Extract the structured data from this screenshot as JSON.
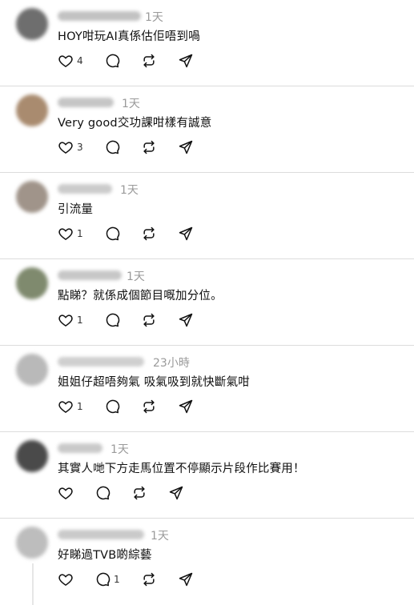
{
  "posts": [
    {
      "time": "1天",
      "text": "HOY咁玩AI真係估佢唔到喎",
      "likes": "4",
      "replies": "",
      "avatar_color": "#6e6e6e",
      "name_color": "#c2c2c2"
    },
    {
      "time": "1天",
      "text": "Very good交功課咁樣有誠意",
      "likes": "3",
      "replies": "",
      "avatar_color": "#a98b6f",
      "name_color": "#c5c5c5"
    },
    {
      "time": "1天",
      "text": "引流量",
      "likes": "1",
      "replies": "",
      "avatar_color": "#a0948a",
      "name_color": "#cbcbcb"
    },
    {
      "time": "1天",
      "text": "點睇？就係成個節目嘅加分位。",
      "likes": "1",
      "replies": "",
      "avatar_color": "#7f8a6e",
      "name_color": "#c7c7c7"
    },
    {
      "time": "23小時",
      "text": "姐姐仔超唔夠氣 吸氣吸到就快斷氣咁",
      "likes": "1",
      "replies": "",
      "avatar_color": "#b9b9b9",
      "name_color": "#cfcfcf"
    },
    {
      "time": "1天",
      "text": "其實人哋下方走馬位置不停顯示片段作比賽用！",
      "likes": "",
      "replies": "",
      "avatar_color": "#4a4a4a",
      "name_color": "#c9c9c9"
    },
    {
      "time": "1天",
      "text": "好睇過TVB啲綜藝",
      "likes": "",
      "replies": "1",
      "avatar_color": "#bdbdbd",
      "name_color": "#cacaca"
    }
  ],
  "icons": {
    "like": "heart-icon",
    "reply": "comment-icon",
    "repost": "repost-icon",
    "share": "share-icon"
  }
}
